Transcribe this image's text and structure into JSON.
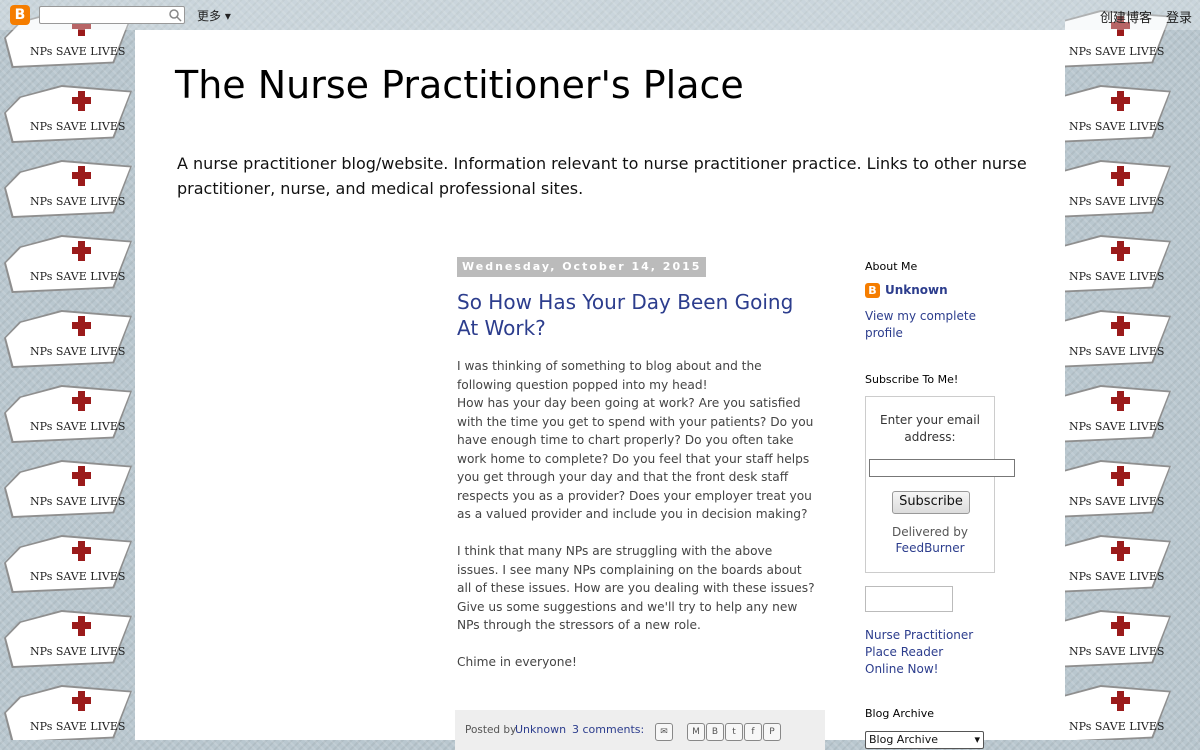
{
  "navbar": {
    "more_label": "更多",
    "create_blog": "创建博客",
    "login": "登录",
    "search_placeholder": ""
  },
  "background_tile_text": "NPs SAVE LIVES",
  "blog": {
    "title": "The Nurse Practitioner's Place",
    "description": "A nurse practitioner blog/website. Information relevant to nurse practitioner practice. Links to other nurse practitioner, nurse, and medical professional sites."
  },
  "post": {
    "date": "Wednesday, October 14, 2015",
    "title": "So How Has Your Day Been Going At Work?",
    "paragraphs": [
      "I was thinking of something to blog about and the following question popped into my head!",
      "How has your day been going at work? Are you satisfied with the time you get to spend with your patients? Do you have enough time to chart properly? Do you often take work home to complete? Do you feel that your staff helps you get through your day and that the front desk staff respects you as a provider? Does your employer treat you as a valued provider and include you in decision making?",
      "I think that many NPs are struggling with the above issues. I see many NPs complaining on the boards about all of these issues. How are you dealing with these issues? Give us some suggestions and we'll try to help any new NPs through the stressors of a new role.",
      "Chime in everyone!"
    ],
    "footer": {
      "posted_by_label": "Posted by",
      "author": "Unknown",
      "comments": "3 comments:"
    }
  },
  "sidebar": {
    "about_heading": "About Me",
    "profile_name": "Unknown",
    "view_profile": "View my complete profile",
    "subscribe_heading": "Subscribe To Me!",
    "email_label": "Enter your email address:",
    "subscribe_button": "Subscribe",
    "delivered_by": "Delivered by",
    "feedburner": "FeedBurner",
    "reader_link": "Nurse Practitioner Place Reader Online Now!",
    "archive_heading": "Blog Archive",
    "archive_select": "Blog Archive"
  },
  "colors": {
    "link": "#2c3d8d",
    "date_header_bg": "#bbbbbb",
    "blogger_orange": "#f57d00",
    "cross_red": "#9b1b1b"
  }
}
